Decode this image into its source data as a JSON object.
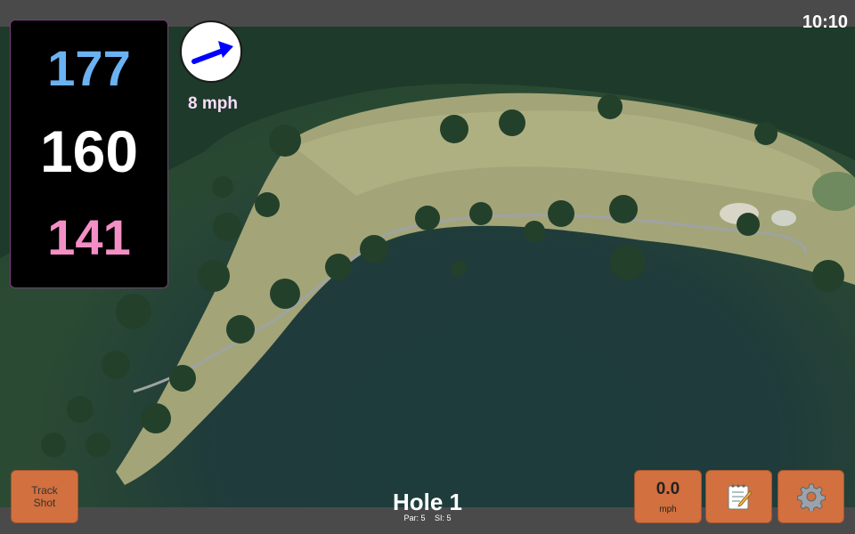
{
  "status": {
    "time": "10:10"
  },
  "distances": {
    "back": "177",
    "center": "160",
    "front": "141"
  },
  "wind": {
    "speed": "8 mph",
    "direction_icon": "wind-arrow-icon"
  },
  "hole": {
    "title": "Hole 1",
    "par": "Par: 5",
    "stroke_index": "SI: 5"
  },
  "buttons": {
    "track_shot": "Track Shot",
    "speed_value": "0.0",
    "speed_unit": "mph",
    "notes_icon": "notepad-icon",
    "settings_icon": "gear-icon"
  },
  "colors": {
    "back_distance": "#6ab2f2",
    "center_distance": "#ffffff",
    "front_distance": "#f48fc6",
    "button": "#d2703f",
    "wind_text": "#fbdcfb",
    "wind_arrow": "#0000ff"
  }
}
